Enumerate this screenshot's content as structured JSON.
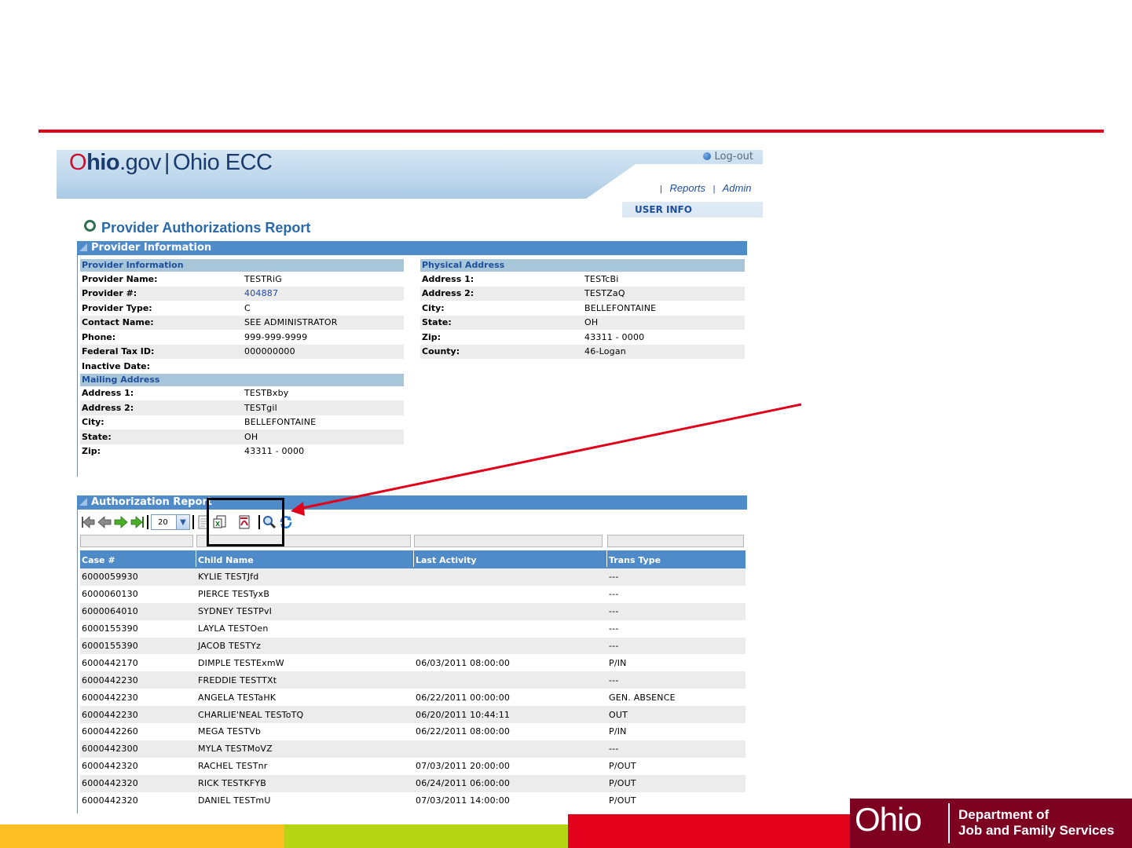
{
  "colors": {
    "accent_red": "#e2001a",
    "app_blue": "#4f8bc9",
    "link_blue": "#1f46b6",
    "ojfs_maroon": "#7d0021",
    "footer_yellow": "#fbbf24",
    "footer_green": "#b5d414"
  },
  "app": {
    "logo_o": "O",
    "logo_hio": "hio",
    "logo_gov": ".gov",
    "logo_sep": "|",
    "logo_ecc": "Ohio ECC",
    "logout_label": "Log-out",
    "nav": {
      "reports": "Reports",
      "admin": "Admin",
      "pipe": "|"
    },
    "user_info": "USER INFO"
  },
  "page": {
    "title": "Provider Authorizations Report"
  },
  "provider_section": {
    "title": "Provider Information",
    "info": {
      "heading": "Provider Information",
      "rows": [
        {
          "label": "Provider Name:",
          "value": "TESTRiG"
        },
        {
          "label": "Provider #:",
          "value": "404887"
        },
        {
          "label": "Provider Type:",
          "value": "C"
        },
        {
          "label": "Contact Name:",
          "value": "SEE ADMINISTRATOR"
        },
        {
          "label": "Phone:",
          "value": "999-999-9999"
        },
        {
          "label": "Federal Tax ID:",
          "value": "000000000"
        },
        {
          "label": "Inactive Date:",
          "value": ""
        }
      ]
    },
    "mailing": {
      "heading": "Mailing Address",
      "rows": [
        {
          "label": "Address 1:",
          "value": "TESTBxby"
        },
        {
          "label": "Address 2:",
          "value": "TESTgil"
        },
        {
          "label": "City:",
          "value": "BELLEFONTAINE"
        },
        {
          "label": "State:",
          "value": "OH"
        },
        {
          "label": "Zip:",
          "value": "43311 - 0000"
        }
      ]
    },
    "physical": {
      "heading": "Physical Address",
      "rows": [
        {
          "label": "Address 1:",
          "value": "TESTcBi"
        },
        {
          "label": "Address 2:",
          "value": "TESTZaQ"
        },
        {
          "label": "City:",
          "value": "BELLEFONTAINE"
        },
        {
          "label": "State:",
          "value": "OH"
        },
        {
          "label": "Zip:",
          "value": "43311 - 0000"
        },
        {
          "label": "County:",
          "value": "46-Logan"
        }
      ]
    }
  },
  "auth_section": {
    "title": "Authorization Report",
    "page_size": "20",
    "columns": [
      "Case #",
      "Child Name",
      "Last Activity",
      "Trans Type"
    ],
    "rows": [
      [
        "6000059930",
        "KYLIE TESTJfd",
        "",
        "---"
      ],
      [
        "6000060130",
        "PIERCE TESTyxB",
        "",
        "---"
      ],
      [
        "6000064010",
        "SYDNEY TESTPvI",
        "",
        "---"
      ],
      [
        "6000155390",
        "LAYLA TESTOen",
        "",
        "---"
      ],
      [
        "6000155390",
        "JACOB TESTYz",
        "",
        "---"
      ],
      [
        "6000442170",
        "DIMPLE TESTExmW",
        "06/03/2011 08:00:00",
        "P/IN"
      ],
      [
        "6000442230",
        "FREDDIE TESTTXt",
        "",
        "---"
      ],
      [
        "6000442230",
        "ANGELA TESTaHK",
        "06/22/2011 00:00:00",
        "GEN. ABSENCE"
      ],
      [
        "6000442230",
        "CHARLIE'NEAL TESToTQ",
        "06/20/2011 10:44:11",
        "OUT"
      ],
      [
        "6000442260",
        "MEGA TESTVb",
        "06/22/2011 08:00:00",
        "P/IN"
      ],
      [
        "6000442300",
        "MYLA TESTMoVZ",
        "",
        "---"
      ],
      [
        "6000442320",
        "RACHEL TESTnr",
        "07/03/2011 20:00:00",
        "P/OUT"
      ],
      [
        "6000442320",
        "RICK TESTKFYB",
        "06/24/2011 06:00:00",
        "P/OUT"
      ],
      [
        "6000442320",
        "DANIEL TESTmU",
        "07/03/2011 14:00:00",
        "P/OUT"
      ]
    ]
  },
  "branding": {
    "ohio": "Ohio",
    "dept_line1": "Department of",
    "dept_line2": "Job and Family Services"
  }
}
